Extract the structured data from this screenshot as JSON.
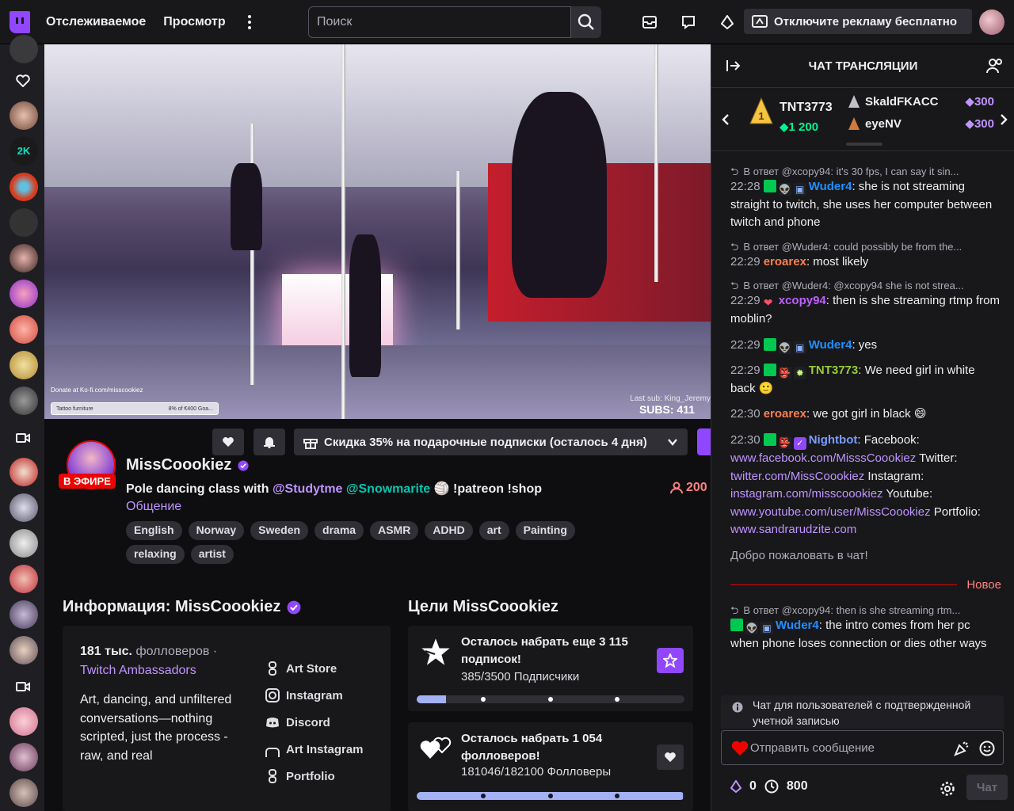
{
  "topbar": {
    "nav": [
      "Отслеживаемое",
      "Просмотр"
    ],
    "search_placeholder": "Поиск",
    "ad_button": "Отключите рекламу бесплатно"
  },
  "video": {
    "overlay_donate": "Donate at Ko-fi.com/misscookiez",
    "overlay_goal_left": "Tattoo furniture",
    "overlay_goal_right": "8% of €400 Goa...",
    "last_sub": "Last sub: King_Jeremy",
    "subs": "SUBS: 411"
  },
  "channel": {
    "gift_button": "Скидка 35% на подарочные подписки (осталось 4 дня)",
    "live_label": "В ЭФИРЕ",
    "name": "MissCoookiez",
    "title_prefix": "Pole dancing class with ",
    "mention1": "@Studytme",
    "mention2": "@Snowmarite",
    "title_suffix": " 🏐 !patreon !shop",
    "category": "Общение",
    "viewers": "200",
    "tags": [
      "English",
      "Norway",
      "Sweden",
      "drama",
      "ASMR",
      "ADHD",
      "art",
      "Painting",
      "relaxing",
      "artist"
    ]
  },
  "about": {
    "title": "Информация: MissCoookiez",
    "followers_count": "181 тыс.",
    "followers_label": "фолловеров ·",
    "team": "Twitch Ambassadors",
    "description": "Art, dancing, and unfiltered conversations—nothing scripted, just the process - raw, and real",
    "links": [
      "Art Store",
      "Instagram",
      "Discord",
      "Art Instagram",
      "Portfolio"
    ]
  },
  "goals": {
    "title": "Цели MissCoookiez",
    "items": [
      {
        "heading": "Осталось набрать еще 3 115 подписок!",
        "progress": "385/3500 Подписчики",
        "fraction": 0.11
      },
      {
        "heading": "Осталось набрать 1 054 фолловеров!",
        "progress": "181046/182100 Фолловеры",
        "fraction": 0.994
      }
    ]
  },
  "chat": {
    "header": "ЧАТ ТРАНСЛЯЦИИ",
    "leaderboard": {
      "first_name": "TNT3773",
      "first_value": "1 200",
      "second_name": "SkaldFKACC",
      "second_points": "300",
      "third_name": "eyeNV",
      "third_points": "300"
    },
    "messages": [
      {
        "reply": "В ответ @xcopy94: it's 30 fps, I can say it sin...",
        "time": "22:28",
        "user": "Wuder4",
        "color": "#1e90ff",
        "text": "she is not streaming straight to twitch, she uses her computer between twitch and phone"
      },
      {
        "reply": "В ответ @Wuder4: could possibly be from the...",
        "time": "22:29",
        "user": "eroarex",
        "color": "#ff7f50",
        "text": "most likely"
      },
      {
        "reply": "В ответ @Wuder4: @xcopy94 she is not strea...",
        "time": "22:29",
        "user": "xcopy94",
        "color": "#bf5fff",
        "text": "then is she streaming rtmp from moblin?"
      },
      {
        "time": "22:29",
        "user": "Wuder4",
        "color": "#1e90ff",
        "text": "yes"
      },
      {
        "time": "22:29",
        "user": "TNT3773",
        "color": "#9acd32",
        "text": "We need girl in white back"
      },
      {
        "time": "22:30",
        "user": "eroarex",
        "color": "#ff7f50",
        "text": "we got girl in black"
      }
    ],
    "nightbot": {
      "time": "22:30",
      "user": "Nightbot",
      "label_fb": "Facebook:",
      "fb": "www.facebook.com/MisssCoookiez",
      "label_tw": "Twitter:",
      "tw": "twitter.com/MissCoookiez",
      "label_ig": "Instagram:",
      "ig": "instagram.com/misscoookiez",
      "label_yt": "Youtube:",
      "yt": "www.youtube.com/user/MissCoookiez",
      "label_pf": "Portfolio:",
      "pf": "www.sandrarudzite.com"
    },
    "welcome": "Добро пожаловать в чат!",
    "new_label": "Новое",
    "last_message": {
      "reply": "В ответ @xcopy94: then is she streaming rtm...",
      "user": "Wuder4",
      "text": "the intro comes from her pc when phone loses connection or dies other ways"
    },
    "notice": "Чат для пользователей с подтвержденной учетной записью",
    "input_placeholder": "Отправить сообщение",
    "points_bits": "0",
    "points_channel": "800",
    "send_label": "Чат"
  }
}
